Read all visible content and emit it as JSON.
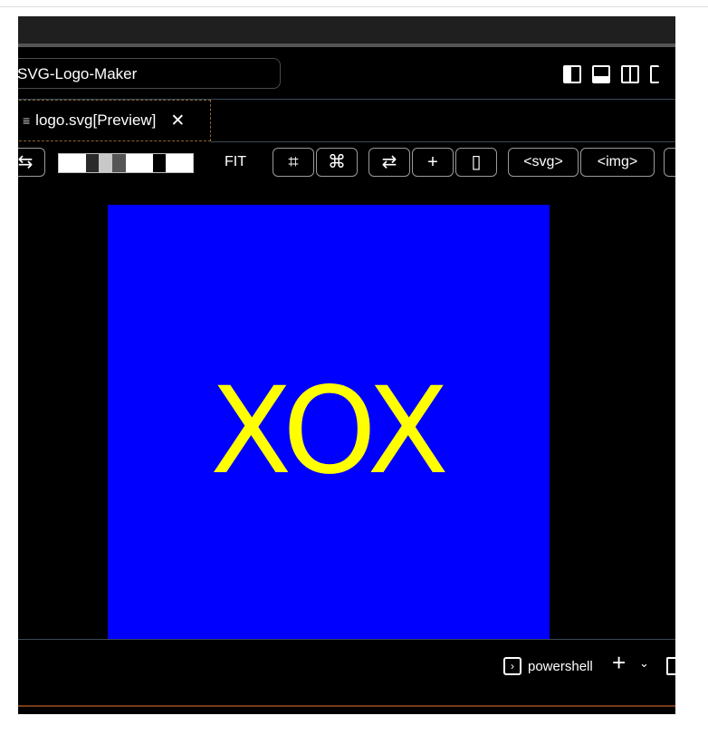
{
  "window": {
    "command_center": "SVG-Logo-Maker"
  },
  "tab": {
    "label": "logo.svg[Preview]",
    "close_glyph": "✕",
    "file_icon": "≡"
  },
  "toolbar": {
    "fit_label": "FIT",
    "swatch_colors": [
      "#ffffff",
      "#ffffff",
      "#2a2a2a",
      "#c8c8c8",
      "#555555",
      "#ffffff",
      "#ffffff",
      "#000000",
      "#ffffff",
      "#ffffff"
    ],
    "buttons": [
      {
        "name": "pin-button",
        "glyph": "⇆"
      },
      {
        "name": "fit-width-button",
        "glyph": "⌗"
      },
      {
        "name": "fit-height-button",
        "glyph": "⌘"
      },
      {
        "name": "swap-button",
        "glyph": "⇄"
      },
      {
        "name": "zoom-in-button",
        "glyph": "+"
      },
      {
        "name": "info-button",
        "glyph": "▯"
      }
    ],
    "svg_button": "<svg>",
    "img_button": "<img>"
  },
  "preview": {
    "logo_text": "XOX",
    "background_color": "#0000ff",
    "text_color": "#ffff00"
  },
  "panel": {
    "terminal_label": "powershell",
    "terminal_icon": "›",
    "plus_glyph": "+",
    "chevron_glyph": "⌄"
  }
}
